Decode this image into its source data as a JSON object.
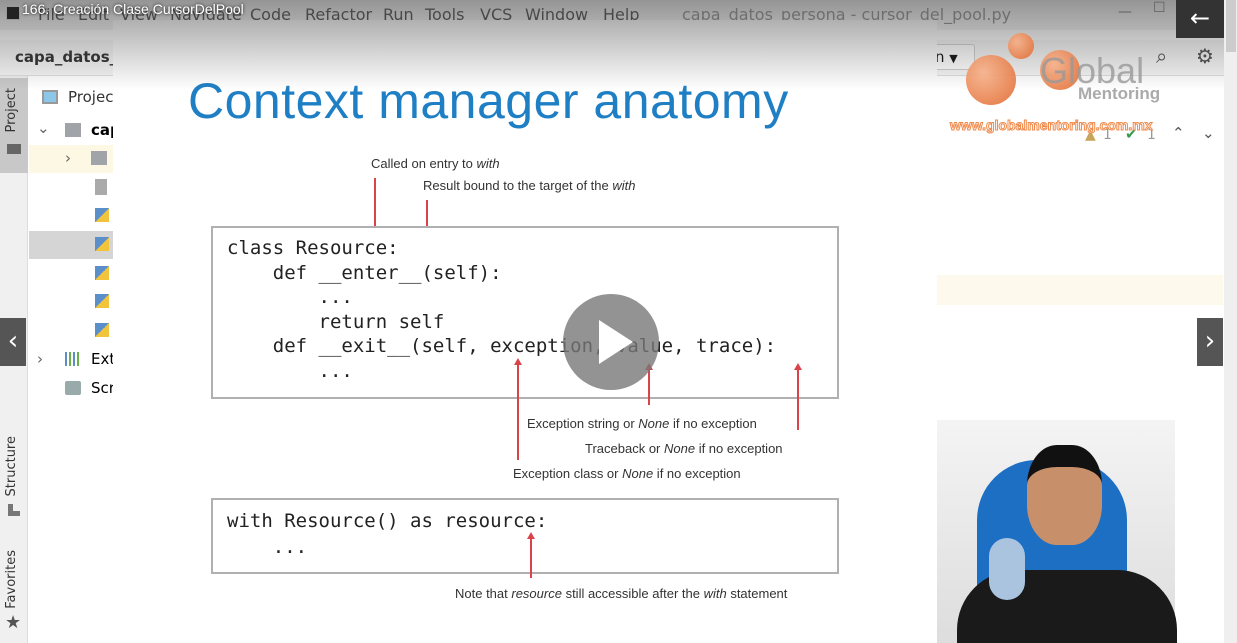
{
  "video": {
    "title": "166. Creación Clase CursorDelPool",
    "back_icon": "arrow-left-icon",
    "prev_icon": "chevron-left-icon",
    "next_icon": "chevron-right-icon",
    "play_icon": "play-icon"
  },
  "ide": {
    "menu": [
      "File",
      "Edit",
      "View",
      "Navigate",
      "Code",
      "Refactor",
      "Run",
      "Tools",
      "VCS",
      "Window",
      "Help"
    ],
    "window_title": "capa_datos_persona - cursor_del_pool.py",
    "breadcrumb": "capa_datos_",
    "run_config": "n",
    "project_panel_title": "Projec",
    "tree_root": "cap",
    "tree_external": "Ext",
    "tree_scratches": "Scr",
    "tool_tabs": {
      "project": "Project",
      "structure": "Structure",
      "favorites": "Favorites"
    },
    "inspections": {
      "warnings": "1",
      "ok": "1"
    }
  },
  "watermark": {
    "brand": "Global",
    "sub": "Mentoring",
    "url": "www.globalmentoring.com.mx"
  },
  "slide": {
    "title": "Context manager anatomy",
    "code1": [
      "class Resource:",
      "    def __enter__(self):",
      "        ...",
      "        return self",
      "    def __exit__(self, exception, value, trace):",
      "        ..."
    ],
    "code2": [
      "with Resource() as resource:",
      "    ..."
    ],
    "notes": {
      "enter_a": "Called on entry to ",
      "enter_b": "with",
      "result_a": "Result bound to the target of the ",
      "result_b": "with",
      "exc_str_a": "Exception string or ",
      "exc_str_b": "None",
      "exc_str_c": " if no exception",
      "tb_a": "Traceback or ",
      "tb_b": "None",
      "tb_c": " if no exception",
      "exc_cls_a": "Exception class or ",
      "exc_cls_b": "None",
      "exc_cls_c": " if no exception",
      "res_a": "Note that ",
      "res_b": "resource",
      "res_c": " still accessible after the ",
      "res_d": "with",
      "res_e": " statement"
    },
    "arrow_color": "#d9434a",
    "title_color": "#1f7fc4"
  }
}
